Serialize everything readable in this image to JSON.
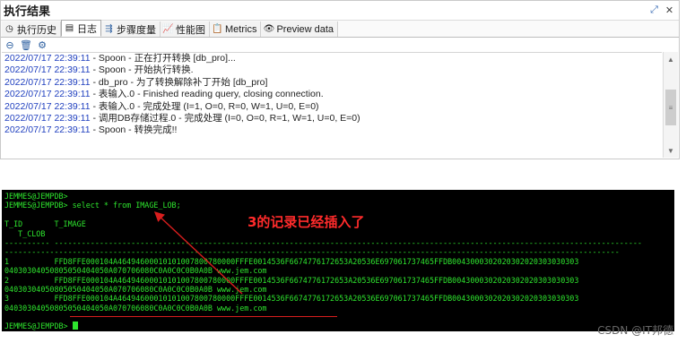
{
  "panel": {
    "title": "执行结果",
    "tabs": [
      {
        "label": "执行历史",
        "icon": "history-icon"
      },
      {
        "label": "日志",
        "icon": "log-icon"
      },
      {
        "label": "步骤度量",
        "icon": "step-metrics-icon"
      },
      {
        "label": "性能图",
        "icon": "performance-chart-icon"
      },
      {
        "label": "Metrics",
        "icon": "metrics-icon"
      },
      {
        "label": "Preview data",
        "icon": "preview-eye-icon"
      }
    ],
    "active_tab": "日志",
    "log_lines": [
      {
        "time": "2022/07/17 22:39:11",
        "text": " - Spoon - 正在打开转换 [db_pro]..."
      },
      {
        "time": "2022/07/17 22:39:11",
        "text": " - Spoon - 开始执行转换."
      },
      {
        "time": "2022/07/17 22:39:11",
        "text": " - db_pro - 为了转换解除补丁开始  [db_pro]"
      },
      {
        "time": "2022/07/17 22:39:11",
        "text": " - 表输入.0 - Finished reading query, closing connection."
      },
      {
        "time": "2022/07/17 22:39:11",
        "text": " - 表输入.0 - 完成处理 (I=1, O=0, R=0, W=1, U=0, E=0)"
      },
      {
        "time": "2022/07/17 22:39:11",
        "text": " - 调用DB存储过程.0 - 完成处理 (I=0, O=0, R=1, W=1, U=0, E=0)"
      },
      {
        "time": "2022/07/17 22:39:11",
        "text": " - Spoon - 转换完成!!"
      }
    ]
  },
  "terminal": {
    "lines": [
      "JEMMES@JEMPDB>",
      "JEMMES@JEMPDB> select * from IMAGE_LOB;",
      "",
      "T_ID       T_IMAGE",
      "   T_CLOB",
      "---------- ----------------------------------------------------------------------------------------------------------------------------------",
      "----------------------------------------------------------------------------------------------------------------------------------------",
      "1          FFD8FFE000104A46494600010101007800780000FFFE0014536F6674776172653A20536E697061737465FFDB0043000302020302020303030303",
      "04030304050805050404050A070706080C0A0C0C0B0A0B www.jem.com",
      "2          FFD8FFE000104A46494600010101007800780000FFFE0014536F6674776172653A20536E697061737465FFDB0043000302020302020303030303",
      "04030304050805050404050A070706080C0A0C0C0B0A0B www.jem.com",
      "3          FFD8FFE000104A46494600010101007800780000FFFE0014536F6674776172653A20536E697061737465FFDB0043000302020302020303030303",
      "04030304050805050404050A070706080C0A0C0C0B0A0B www.jem.com",
      "",
      "JEMMES@JEMPDB> "
    ]
  },
  "annotation": {
    "text": "3的记录已经插入了",
    "color": "#ff2b2b"
  },
  "watermark": "CSDN @IT邦德"
}
